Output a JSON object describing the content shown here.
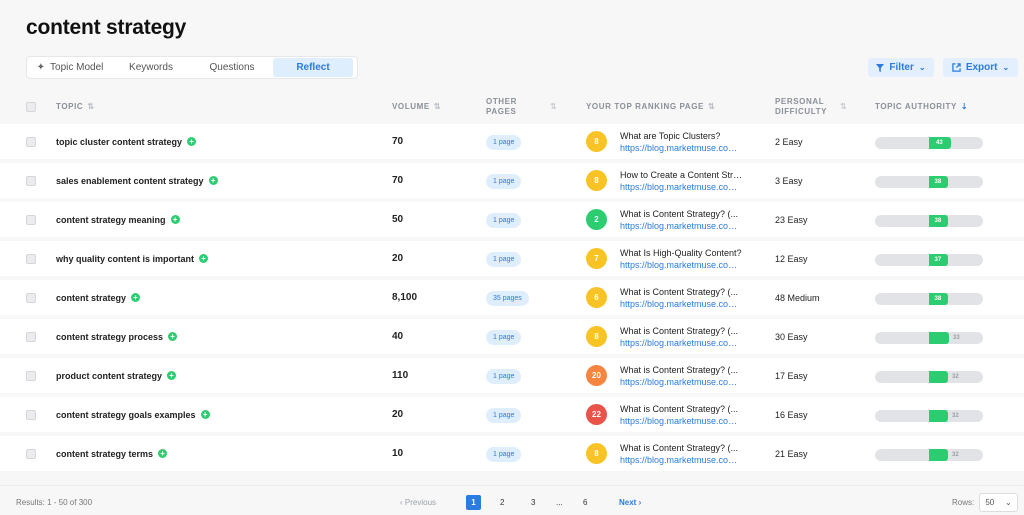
{
  "page_title": "content strategy",
  "tabs": [
    {
      "label": "Topic Model",
      "active": false,
      "icon": "sparkle-icon"
    },
    {
      "label": "Keywords",
      "active": false
    },
    {
      "label": "Questions",
      "active": false
    },
    {
      "label": "Reflect",
      "active": true
    }
  ],
  "toolbar": {
    "filter_label": "Filter",
    "export_label": "Export"
  },
  "columns": {
    "topic": "TOPIC",
    "volume": "VOLUME",
    "other_pages_1": "OTHER",
    "other_pages_2": "PAGES",
    "top_page": "YOUR TOP RANKING PAGE",
    "difficulty_1": "PERSONAL",
    "difficulty_2": "DIFFICULTY",
    "authority": "TOPIC AUTHORITY"
  },
  "colors": {
    "accent": "#2b7be0",
    "green": "#2ecc71",
    "yellow": "#f7c325",
    "orange": "#f5853f",
    "red": "#e8534a"
  },
  "rows": [
    {
      "topic": "topic cluster content strategy",
      "volume": "70",
      "other_pages": "1 page",
      "rank": "8",
      "rank_color": "yellow",
      "page_title": "What are Topic Clusters?",
      "page_url": "https://blog.marketmuse.com/topic-clusters/",
      "difficulty": "2  Easy",
      "authority": 43
    },
    {
      "topic": "sales enablement content strategy",
      "volume": "70",
      "other_pages": "1 page",
      "rank": "8",
      "rank_color": "yellow",
      "page_title": "How to Create a Content Strategy",
      "page_url": "https://blog.marketmuse.com/content-strategy/",
      "difficulty": "3  Easy",
      "authority": 38
    },
    {
      "topic": "content strategy meaning",
      "volume": "50",
      "other_pages": "1 page",
      "rank": "2",
      "rank_color": "green",
      "page_title": "What is Content Strategy? (...",
      "page_url": "https://blog.marketmuse.com/what-is-content-strategy/",
      "difficulty": "23  Easy",
      "authority": 38
    },
    {
      "topic": "why quality content is important",
      "volume": "20",
      "other_pages": "1 page",
      "rank": "7",
      "rank_color": "yellow",
      "page_title": "What Is High-Quality Content?",
      "page_url": "https://blog.marketmuse.com/high-quality-content/",
      "difficulty": "12  Easy",
      "authority": 37
    },
    {
      "topic": "content strategy",
      "volume": "8,100",
      "other_pages": "35 pages",
      "rank": "6",
      "rank_color": "yellow",
      "page_title": "What is Content Strategy? (...",
      "page_url": "https://blog.marketmuse.com/what-is-content-strategy/",
      "difficulty": "48  Medium",
      "authority": 38
    },
    {
      "topic": "content strategy process",
      "volume": "40",
      "other_pages": "1 page",
      "rank": "8",
      "rank_color": "yellow",
      "page_title": "What is Content Strategy? (...",
      "page_url": "https://blog.marketmuse.com/what-is-content-strategy/",
      "difficulty": "30  Easy",
      "authority": 33
    },
    {
      "topic": "product content strategy",
      "volume": "110",
      "other_pages": "1 page",
      "rank": "20",
      "rank_color": "orange",
      "page_title": "What is Content Strategy? (...",
      "page_url": "https://blog.marketmuse.com/what-is-content-strategy/",
      "difficulty": "17  Easy",
      "authority": 32
    },
    {
      "topic": "content strategy goals examples",
      "volume": "20",
      "other_pages": "1 page",
      "rank": "22",
      "rank_color": "red",
      "page_title": "What is Content Strategy? (...",
      "page_url": "https://blog.marketmuse.com/what-is-content-strategy/",
      "difficulty": "16  Easy",
      "authority": 32
    },
    {
      "topic": "content strategy terms",
      "volume": "10",
      "other_pages": "1 page",
      "rank": "8",
      "rank_color": "yellow",
      "page_title": "What is Content Strategy? (...",
      "page_url": "https://blog.marketmuse.com/what-is-content-strategy/",
      "difficulty": "21  Easy",
      "authority": 32
    }
  ],
  "pagination": {
    "results": "Results: 1 - 50 of 300",
    "previous": "Previous",
    "pages": [
      "1",
      "2",
      "3",
      "...",
      "6"
    ],
    "current": "1",
    "next": "Next",
    "rows_label": "Rows:",
    "rows_value": "50"
  }
}
